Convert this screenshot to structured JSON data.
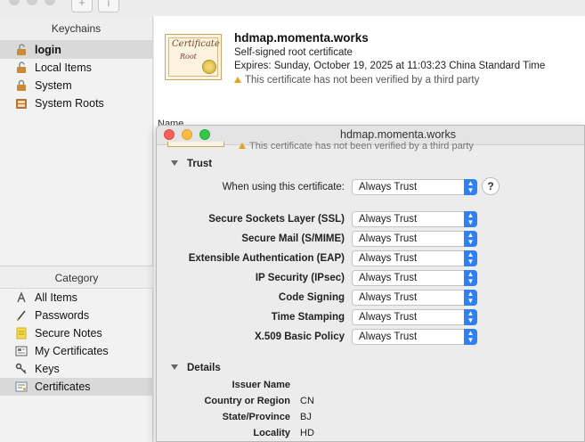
{
  "toolbar": {
    "add_label": "+",
    "info_label": "i"
  },
  "sidebar": {
    "keychains_header": "Keychains",
    "keychains": [
      {
        "label": "login",
        "icon": "lock-open-icon",
        "selected": true
      },
      {
        "label": "Local Items",
        "icon": "lock-open-icon"
      },
      {
        "label": "System",
        "icon": "lock-icon"
      },
      {
        "label": "System Roots",
        "icon": "cabinet-icon"
      }
    ],
    "category_header": "Category",
    "categories": [
      {
        "label": "All Items",
        "icon": "all-items-icon"
      },
      {
        "label": "Passwords",
        "icon": "key-pencil-icon"
      },
      {
        "label": "Secure Notes",
        "icon": "note-icon"
      },
      {
        "label": "My Certificates",
        "icon": "my-cert-icon"
      },
      {
        "label": "Keys",
        "icon": "key-icon"
      },
      {
        "label": "Certificates",
        "icon": "certificate-icon",
        "selected": true
      }
    ]
  },
  "cert": {
    "title": "hdmap.momenta.works",
    "subtitle": "Self-signed root certificate",
    "expires": "Expires: Sunday, October 19, 2025 at 11:03:23 China Standard Time",
    "warning": "This certificate has not been verified by a third party",
    "image_text": "Certificate",
    "image_text2": "Root"
  },
  "list": {
    "name_column": "Name"
  },
  "dialog": {
    "title": "hdmap.momenta.works",
    "warning": "This certificate has not been verified by a third party",
    "trust_section": "Trust",
    "when_using_label": "When using this certificate:",
    "when_using_value": "Always Trust",
    "help": "?",
    "policies": [
      {
        "label": "Secure Sockets Layer (SSL)",
        "value": "Always Trust"
      },
      {
        "label": "Secure Mail (S/MIME)",
        "value": "Always Trust"
      },
      {
        "label": "Extensible Authentication (EAP)",
        "value": "Always Trust"
      },
      {
        "label": "IP Security (IPsec)",
        "value": "Always Trust"
      },
      {
        "label": "Code Signing",
        "value": "Always Trust"
      },
      {
        "label": "Time Stamping",
        "value": "Always Trust"
      },
      {
        "label": "X.509 Basic Policy",
        "value": "Always Trust"
      }
    ],
    "details_section": "Details",
    "issuer_name": "Issuer Name",
    "details": [
      {
        "label": "Country or Region",
        "value": "CN"
      },
      {
        "label": "State/Province",
        "value": "BJ"
      },
      {
        "label": "Locality",
        "value": "HD"
      }
    ]
  },
  "colors": {
    "accent": "#2f7ff5",
    "warning": "#e3a21a",
    "close": "#fc605b",
    "minimize": "#fdbc40",
    "zoom": "#34c84a"
  }
}
